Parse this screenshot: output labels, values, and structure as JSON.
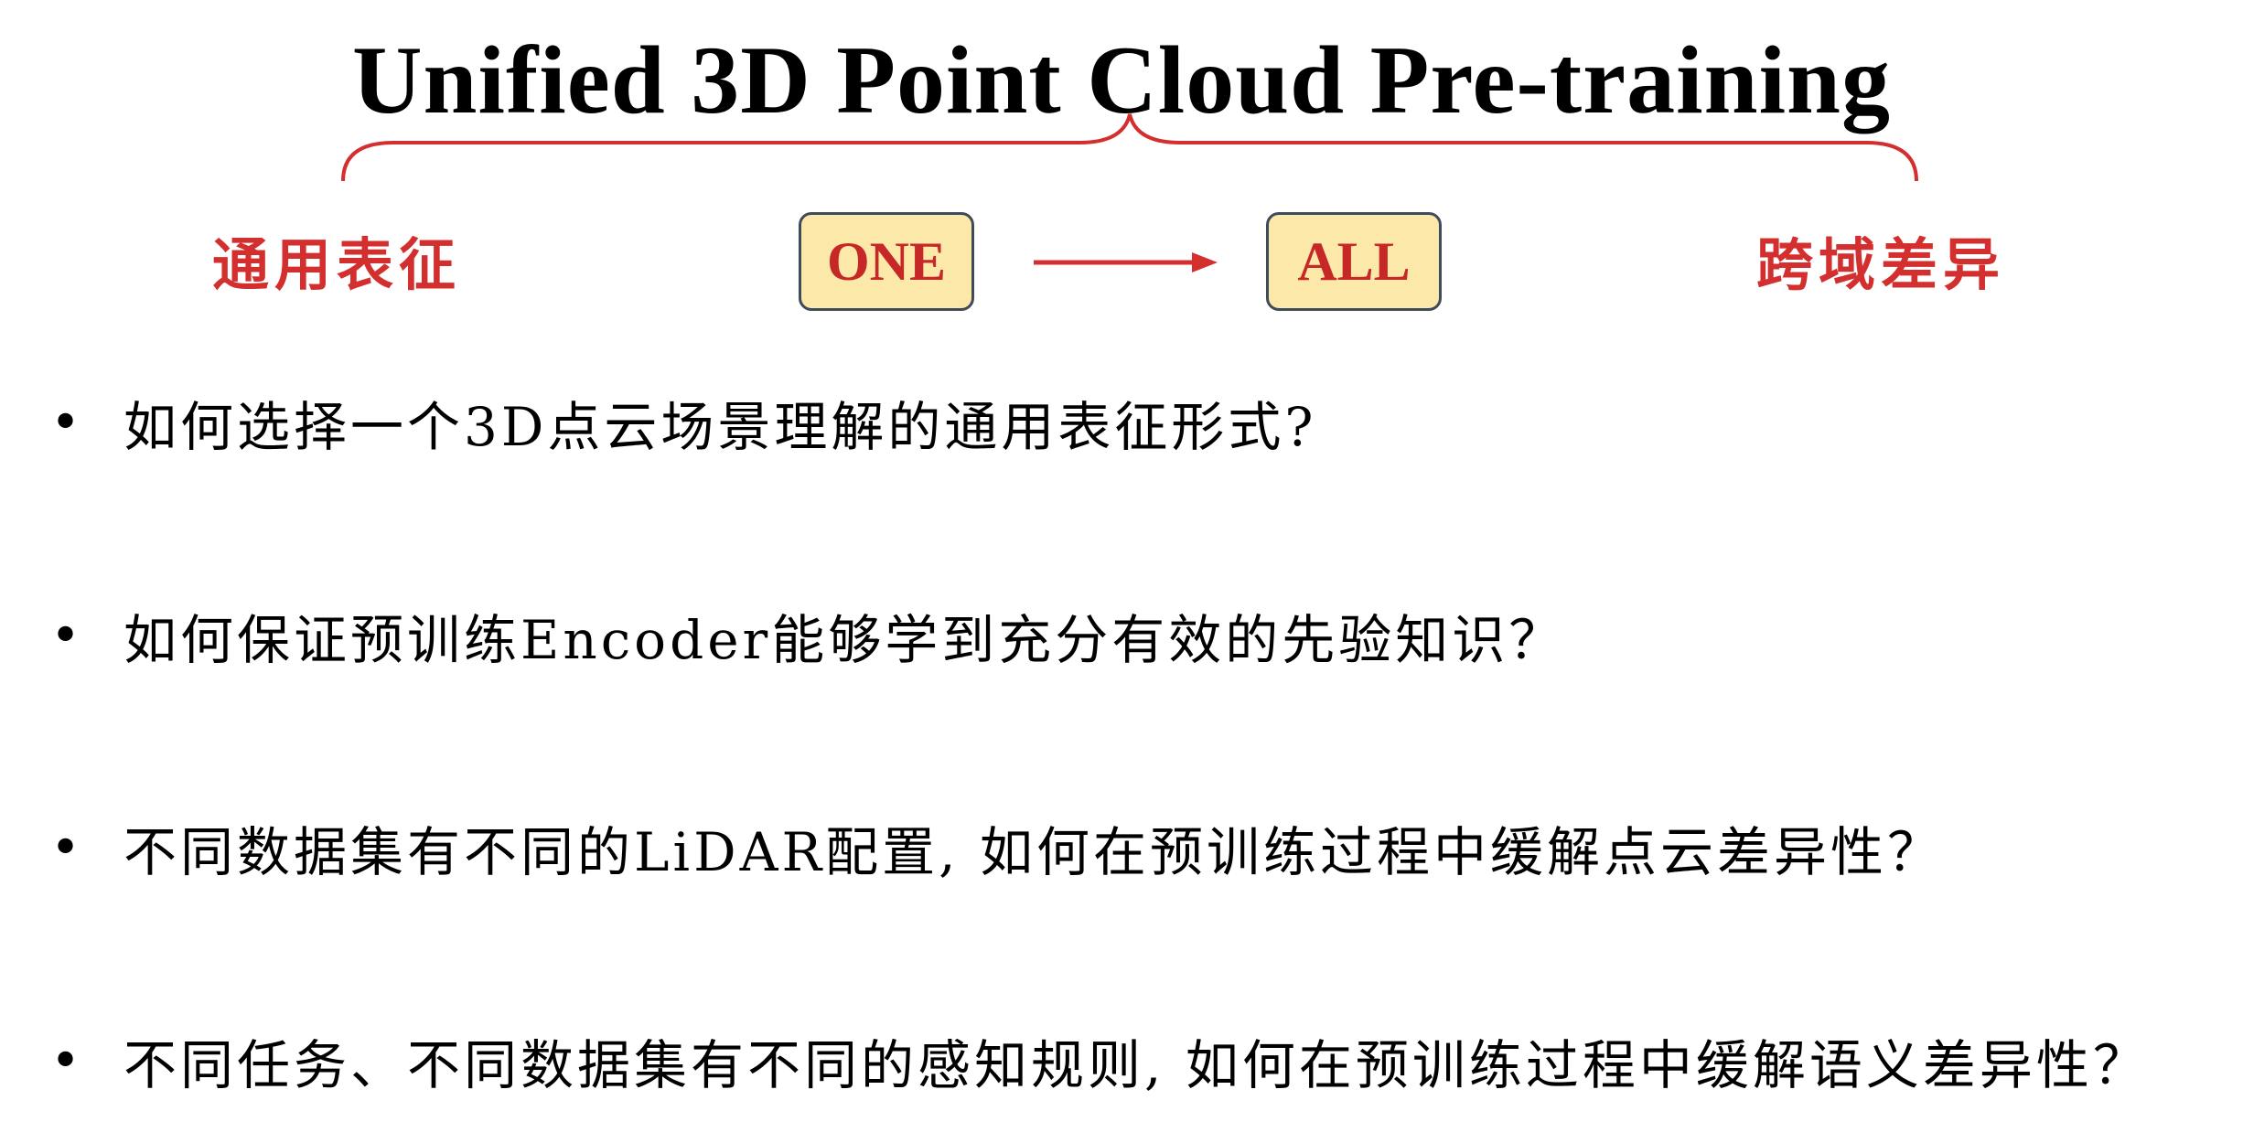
{
  "title": "Unified 3D Point Cloud Pre-training",
  "labels": {
    "left": "通用表征",
    "right": "跨域差异"
  },
  "boxes": {
    "one": "ONE",
    "all": "ALL"
  },
  "colors": {
    "accent_red": "#d32f2f",
    "box_fill": "#fce8a8",
    "box_border": "#3f4a5a"
  },
  "bullets": [
    "如何选择一个3D点云场景理解的通用表征形式?",
    "如何保证预训练Encoder能够学到充分有效的先验知识？",
    "不同数据集有不同的LiDAR配置, 如何在预训练过程中缓解点云差异性？",
    "不同任务、不同数据集有不同的感知规则, 如何在预训练过程中缓解语义差异性？"
  ],
  "bullet_symbol": "•"
}
